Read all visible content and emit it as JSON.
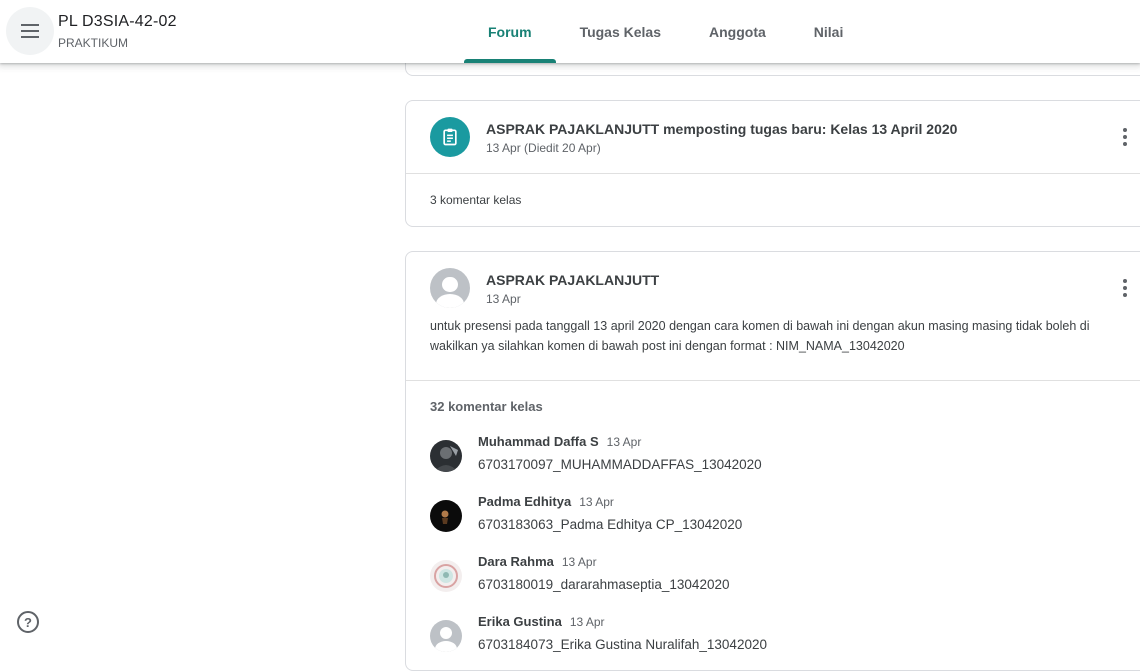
{
  "header": {
    "class_name": "PL D3SIA-42-02",
    "class_section": "PRAKTIKUM",
    "menu_icon": "hamburger-menu-icon"
  },
  "tabs": [
    {
      "label": "Forum",
      "active": true
    },
    {
      "label": "Tugas Kelas",
      "active": false
    },
    {
      "label": "Anggota",
      "active": false
    },
    {
      "label": "Nilai",
      "active": false
    }
  ],
  "accent_color": "#188175",
  "assignment_post": {
    "icon": "assignment-icon",
    "title": "ASPRAK PAJAKLANJUTT memposting tugas baru: Kelas 13 April 2020",
    "date": "13 Apr (Diedit 20 Apr)",
    "comment_count": "3 komentar kelas"
  },
  "announcement": {
    "author": "ASPRAK PAJAKLANJUTT",
    "date": "13 Apr",
    "text": "untuk presensi pada tanggall 13 april 2020 dengan cara komen di bawah ini dengan akun masing masing tidak boleh di wakilkan ya silahkan komen di bawah post ini dengan format : NIM_NAMA_13042020",
    "comment_count": "32 komentar kelas",
    "comments": [
      {
        "name": "Muhammad Daffa S",
        "time": "13 Apr",
        "text": "6703170097_MUHAMMADDAFFAS_13042020",
        "avatar": "photo-dark"
      },
      {
        "name": "Padma Edhitya",
        "time": "13 Apr",
        "text": "6703183063_Padma Edhitya CP_13042020",
        "avatar": "photo-black"
      },
      {
        "name": "Dara Rahma",
        "time": "13 Apr",
        "text": "6703180019_dararahmaseptia_13042020",
        "avatar": "photo-light"
      },
      {
        "name": "Erika Gustina",
        "time": "13 Apr",
        "text": "6703184073_Erika Gustina Nuralifah_13042020",
        "avatar": "default"
      }
    ]
  },
  "help_icon": "help-circle-icon"
}
